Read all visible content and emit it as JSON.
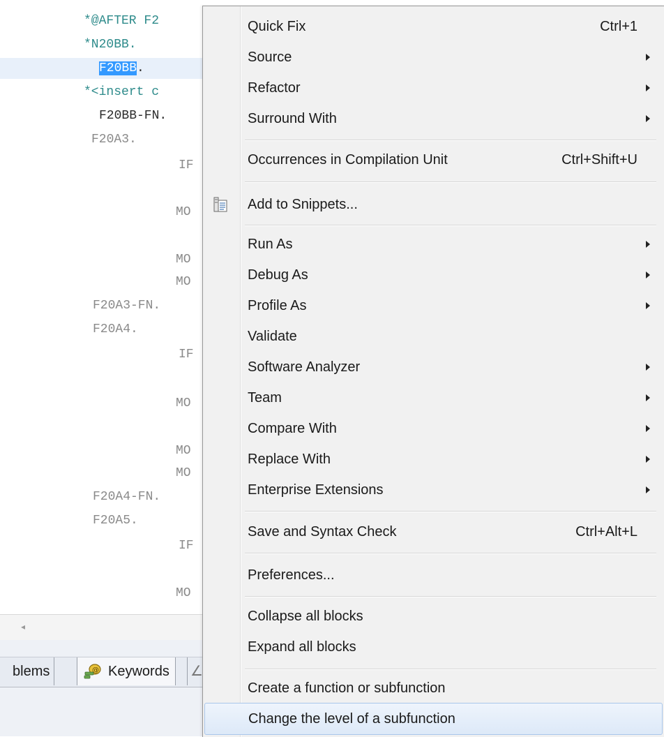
{
  "editor": {
    "lines": [
      {
        "text": "*@AFTER F2",
        "style": "comment"
      },
      {
        "text": "*N20BB.",
        "style": "comment"
      },
      {
        "text_pre": "",
        "selected": "F20BB",
        "text_post": ".",
        "style": "dark"
      },
      {
        "text": "*<insert c",
        "style": "comment"
      },
      {
        "text": "F20BB-FN.",
        "style": "dark"
      },
      {
        "text": "F20A3.",
        "style": "gray"
      },
      {
        "text": "IF",
        "style": "gray"
      },
      {
        "text": "MO",
        "style": "gray"
      },
      {
        "text": "MO",
        "style": "gray"
      },
      {
        "text": "MO",
        "style": "gray"
      },
      {
        "text": "F20A3-FN.",
        "style": "gray"
      },
      {
        "text": "F20A4.",
        "style": "gray"
      },
      {
        "text": "IF",
        "style": "gray"
      },
      {
        "text": "MO",
        "style": "gray"
      },
      {
        "text": "MO",
        "style": "gray"
      },
      {
        "text": "MO",
        "style": "gray"
      },
      {
        "text": "F20A4-FN.",
        "style": "gray"
      },
      {
        "text": "F20A5.",
        "style": "gray"
      },
      {
        "text": "IF",
        "style": "gray"
      },
      {
        "text": "MO",
        "style": "gray"
      }
    ],
    "colors": {
      "comment": "#2e8b8b",
      "dark": "#2b2b2b",
      "gray": "#8a8a8a",
      "selection": "#3399ff",
      "line_highlight": "#e8f0fa"
    }
  },
  "views": {
    "tab_problems": "blems",
    "tab_keywords": "Keywords",
    "tab_more": "∠"
  },
  "scrollbar": {
    "left_arrow": "◂"
  },
  "menu": {
    "items": [
      {
        "label": "Quick Fix",
        "shortcut": "Ctrl+1",
        "submenu": false
      },
      {
        "label": "Source",
        "shortcut": "",
        "submenu": true
      },
      {
        "label": "Refactor",
        "shortcut": "",
        "submenu": true
      },
      {
        "label": "Surround With",
        "shortcut": "",
        "submenu": true
      },
      {
        "label": "Occurrences in Compilation Unit",
        "shortcut": "Ctrl+Shift+U",
        "submenu": false
      },
      {
        "label": "Add to Snippets...",
        "shortcut": "",
        "submenu": false,
        "icon": "snippet-icon"
      },
      {
        "label": "Run As",
        "shortcut": "",
        "submenu": true
      },
      {
        "label": "Debug As",
        "shortcut": "",
        "submenu": true
      },
      {
        "label": "Profile As",
        "shortcut": "",
        "submenu": true
      },
      {
        "label": "Validate",
        "shortcut": "",
        "submenu": false
      },
      {
        "label": "Software Analyzer",
        "shortcut": "",
        "submenu": true
      },
      {
        "label": "Team",
        "shortcut": "",
        "submenu": true
      },
      {
        "label": "Compare With",
        "shortcut": "",
        "submenu": true
      },
      {
        "label": "Replace With",
        "shortcut": "",
        "submenu": true
      },
      {
        "label": "Enterprise Extensions",
        "shortcut": "",
        "submenu": true
      },
      {
        "label": "Save and Syntax Check",
        "shortcut": "Ctrl+Alt+L",
        "submenu": false
      },
      {
        "label": "Preferences...",
        "shortcut": "",
        "submenu": false
      },
      {
        "label": "Collapse all blocks",
        "shortcut": "",
        "submenu": false
      },
      {
        "label": "Expand all blocks",
        "shortcut": "",
        "submenu": false
      },
      {
        "label": "Create a function or subfunction",
        "shortcut": "",
        "submenu": false
      },
      {
        "label": "Change the level of a subfunction",
        "shortcut": "",
        "submenu": false,
        "hovered": true
      }
    ]
  }
}
